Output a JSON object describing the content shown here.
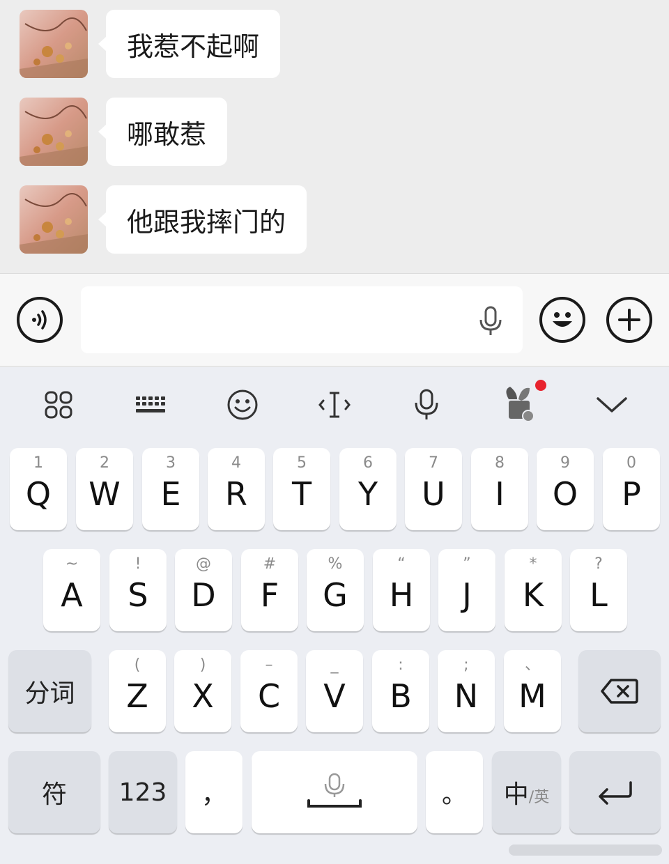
{
  "chat": {
    "messages": [
      {
        "text": "我惹不起啊"
      },
      {
        "text": "哪敢惹"
      },
      {
        "text": "他跟我摔门的"
      }
    ]
  },
  "input_bar": {
    "field_value": "",
    "icons": [
      "voice-mode-icon",
      "microphone-icon",
      "emoji-icon",
      "plus-icon"
    ]
  },
  "keyboard": {
    "toolbar_icons": [
      "apps-grid-icon",
      "keyboard-icon",
      "emoji-face-icon",
      "text-cursor-icon",
      "microphone-icon",
      "plant-skin-icon",
      "collapse-chevron-icon"
    ],
    "row1": [
      {
        "sub": "1",
        "main": "Q"
      },
      {
        "sub": "2",
        "main": "W"
      },
      {
        "sub": "3",
        "main": "E"
      },
      {
        "sub": "4",
        "main": "R"
      },
      {
        "sub": "5",
        "main": "T"
      },
      {
        "sub": "6",
        "main": "Y"
      },
      {
        "sub": "7",
        "main": "U"
      },
      {
        "sub": "8",
        "main": "I"
      },
      {
        "sub": "9",
        "main": "O"
      },
      {
        "sub": "0",
        "main": "P"
      }
    ],
    "row2": [
      {
        "sub": "~",
        "main": "A"
      },
      {
        "sub": "!",
        "main": "S"
      },
      {
        "sub": "@",
        "main": "D"
      },
      {
        "sub": "#",
        "main": "F"
      },
      {
        "sub": "%",
        "main": "G"
      },
      {
        "sub": "“",
        "main": "H"
      },
      {
        "sub": "”",
        "main": "J"
      },
      {
        "sub": "*",
        "main": "K"
      },
      {
        "sub": "?",
        "main": "L"
      }
    ],
    "row3": [
      {
        "sub": "(",
        "main": "Z"
      },
      {
        "sub": ")",
        "main": "X"
      },
      {
        "sub": "–",
        "main": "C"
      },
      {
        "sub": "_",
        "main": "V"
      },
      {
        "sub": ":",
        "main": "B"
      },
      {
        "sub": ";",
        "main": "N"
      },
      {
        "sub": "、",
        "main": "M"
      }
    ],
    "segment_label": "分词",
    "symbol_label": "符",
    "numeric_label": "123",
    "comma_label": "，",
    "period_label": "。",
    "lang_main": "中",
    "lang_sub": "/英"
  },
  "colors": {
    "chat_bg": "#ededed",
    "keyboard_bg": "#eceef3",
    "notification_dot": "#e8232e"
  }
}
